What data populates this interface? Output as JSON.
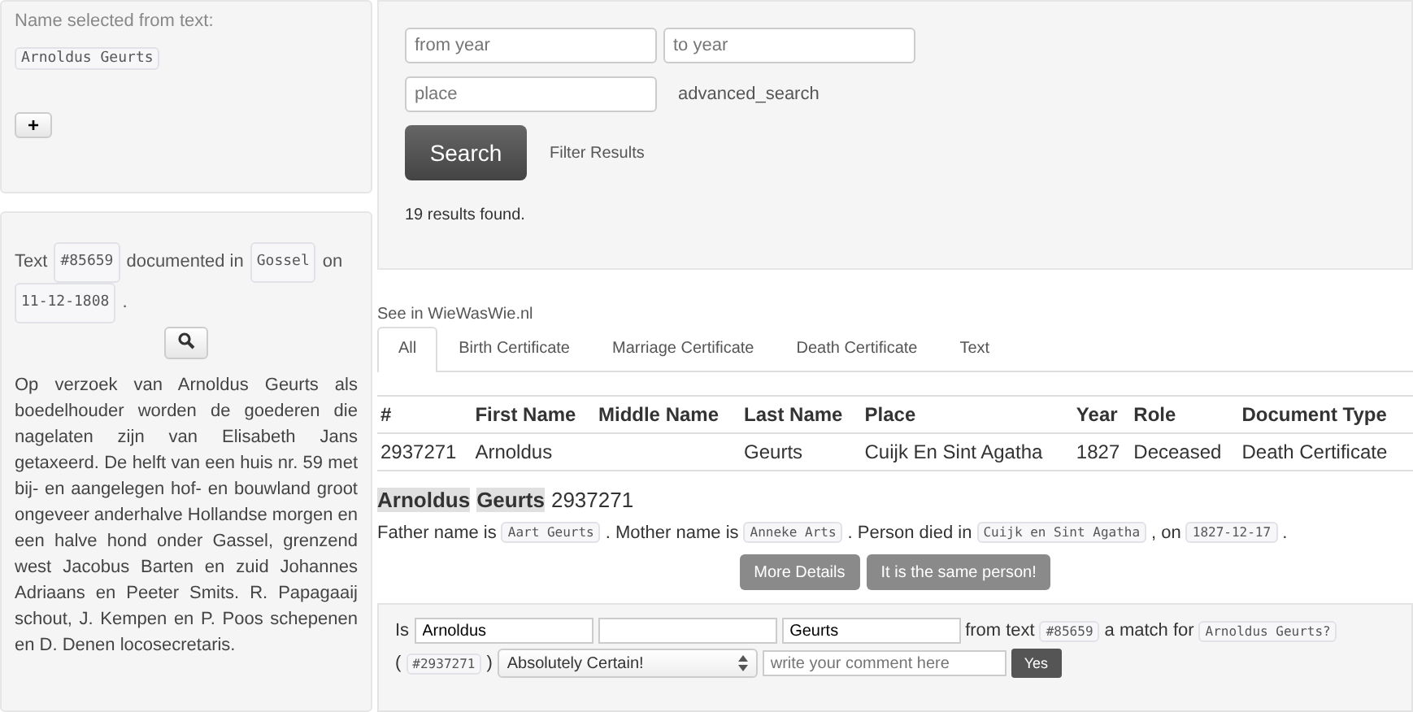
{
  "selection": {
    "label": "Name selected from text:",
    "name": "Arnoldus Geurts",
    "add_button": "+"
  },
  "text_info": {
    "sentence": [
      {
        "kind": "text",
        "text": "Text"
      },
      {
        "kind": "code",
        "text": "#85659"
      },
      {
        "kind": "text",
        "text": "documented in"
      },
      {
        "kind": "code",
        "text": "Gossel"
      },
      {
        "kind": "text",
        "text": "on"
      },
      {
        "kind": "code",
        "text": "11-12-1808"
      },
      {
        "kind": "text",
        "text": "."
      }
    ],
    "body": "Op verzoek van Arnoldus Geurts als boedelhouder worden de goederen die nagelaten zijn van Elisabeth Jans getaxeerd. De helft van een huis nr. 59 met bij- en aangelegen hof- en bouwland groot ongeveer anderhalve Hollandse morgen en een halve hond onder Gassel, grenzend west Jacobus Barten en zuid Johannes Adriaans en Peeter Smits. R. Papagaaij schout, J. Kempen en P. Poos schepenen en D. Denen locosecretaris."
  },
  "search": {
    "from_year": {
      "placeholder": "from year"
    },
    "to_year": {
      "placeholder": "to year"
    },
    "place": {
      "placeholder": "place"
    },
    "advanced": "advanced_search",
    "button": "Search",
    "filter": "Filter Results",
    "results": "19 results found."
  },
  "link": "See in WieWasWie.nl",
  "tabs": [
    {
      "label": "All",
      "selected": true
    },
    {
      "label": "Birth Certificate",
      "selected": false
    },
    {
      "label": "Marriage Certificate",
      "selected": false
    },
    {
      "label": "Death Certificate",
      "selected": false
    },
    {
      "label": "Text",
      "selected": false
    }
  ],
  "table": {
    "columns": [
      "#",
      "First Name",
      "Middle Name",
      "Last Name",
      "Place",
      "Year",
      "Role",
      "Document Type"
    ],
    "rows": [
      [
        "2937271",
        "Arnoldus",
        null,
        "Geurts",
        "Cuijk En Sint Agatha",
        "1827",
        "Deceased",
        "Death Certificate"
      ]
    ]
  },
  "detail": {
    "heading": [
      {
        "kind": "highlight",
        "text": "Arnoldus"
      },
      {
        "kind": "highlight",
        "text": "Geurts"
      },
      {
        "kind": "text",
        "text": "2937271"
      }
    ],
    "sentence": [
      {
        "kind": "text",
        "text": "Father name is"
      },
      {
        "kind": "code",
        "text": "Aart Geurts"
      },
      {
        "kind": "text",
        "text": ". Mother name is"
      },
      {
        "kind": "code",
        "text": "Anneke Arts"
      },
      {
        "kind": "text",
        "text": ". Person died in"
      },
      {
        "kind": "code",
        "text": "Cuijk en Sint Agatha"
      },
      {
        "kind": "text",
        "text": ", on"
      },
      {
        "kind": "code",
        "text": "1827-12-17"
      },
      {
        "kind": "text",
        "text": "."
      }
    ],
    "buttons": [
      "More Details",
      "It is the same person!"
    ]
  },
  "match": {
    "is": "Is",
    "first": "Arnoldus",
    "last": "Geurts",
    "from_text": "from text",
    "text_id": "#85659",
    "match_for": "a match for",
    "name": "Arnoldus Geurts?",
    "open": "(",
    "person_id": "#2937271",
    "close": ")",
    "certainty": "Absolutely Certain!",
    "comment": {
      "placeholder": "write your comment here"
    },
    "yes": "Yes"
  }
}
